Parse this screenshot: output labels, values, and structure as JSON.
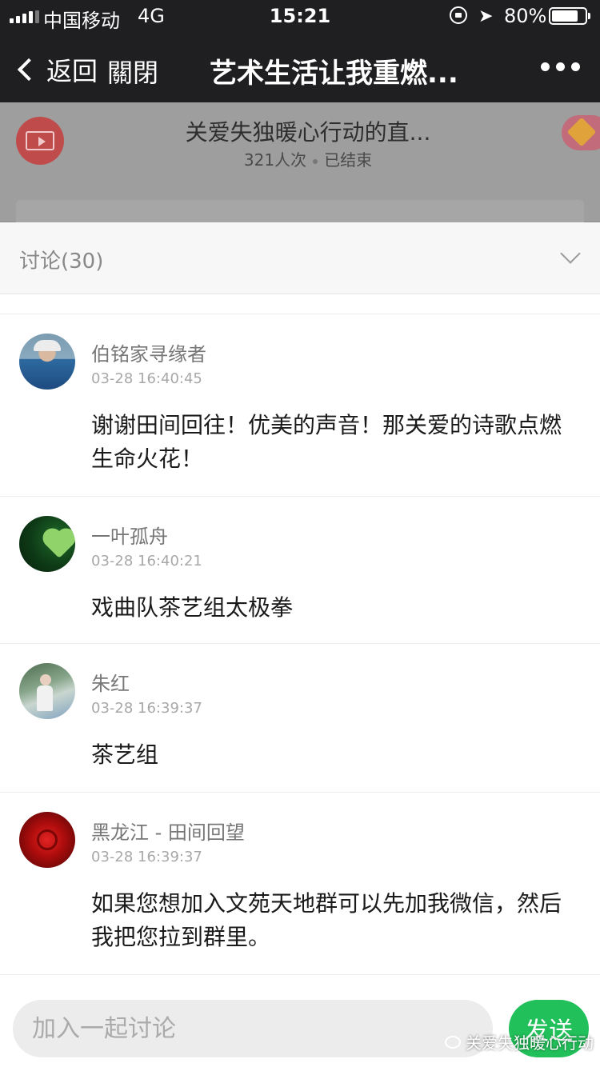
{
  "status_bar": {
    "carrier": "中国移动",
    "network": "4G",
    "time": "15:21",
    "battery_percent": "80%",
    "battery_level": 0.8
  },
  "nav": {
    "back_label": "返回",
    "close_label": "關閉",
    "title": "艺术生活让我重燃..."
  },
  "live_card": {
    "title": "关爱失独暖心行动的直...",
    "views": "321人次",
    "status": "已结束"
  },
  "discussion": {
    "header": "讨论(30)",
    "comments": [
      {
        "author": "伯铭家寻缘者",
        "time": "03-28 16:40:45",
        "text": "谢谢田间回往！优美的声音！那关爱的诗歌点燃生命火花！"
      },
      {
        "author": "一叶孤舟",
        "time": "03-28 16:40:21",
        "text": "戏曲队茶艺组太极拳"
      },
      {
        "author": "朱红",
        "time": "03-28 16:39:37",
        "text": "茶艺组"
      },
      {
        "author": "黑龙江 - 田间回望",
        "time": "03-28 16:39:37",
        "text": "如果您想加入文苑天地群可以先加我微信，然后我把您拉到群里。"
      }
    ]
  },
  "input": {
    "placeholder": "加入一起讨论",
    "send_label": "发送"
  },
  "watermark": "关爱失独暖心行动",
  "colors": {
    "nav_bg": "#1f1f21",
    "send_button": "#22c05a",
    "overlay_card": "#9e9e9e"
  }
}
